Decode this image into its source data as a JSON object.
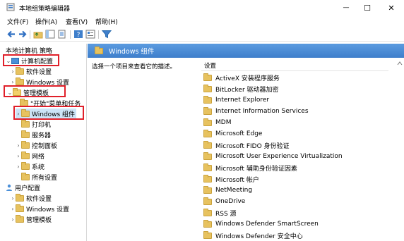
{
  "window": {
    "title": "本地组策略编辑器",
    "minimize_glyph": "—",
    "maximize_glyph": "☐",
    "close_glyph": "✕"
  },
  "menu": [
    "文件(F)",
    "操作(A)",
    "查看(V)",
    "帮助(H)"
  ],
  "toolbar": {
    "icons": [
      "back-arrow-icon",
      "forward-arrow-icon",
      "up-folder-icon",
      "show-hide-tree-icon",
      "export-list-icon",
      "help-icon",
      "properties-icon",
      "filter-icon"
    ]
  },
  "tree": {
    "root": "本地计算机 策略",
    "computer_config": "计算机配置",
    "software_settings_1": "软件设置",
    "windows_settings_1": "Windows 设置",
    "admin_templates_1": "管理模板",
    "start_menu": "\"开始\"菜单和任务",
    "windows_components": "Windows 组件",
    "printers": "打印机",
    "server": "服务器",
    "control_panel": "控制面板",
    "network": "网络",
    "system": "系统",
    "all_settings": "所有设置",
    "user_config": "用户配置",
    "software_settings_2": "软件设置",
    "windows_settings_2": "Windows 设置",
    "admin_templates_2": "管理模板"
  },
  "right_pane": {
    "header": "Windows 组件",
    "description": "选择一个项目来查看它的描述。",
    "column_header": "设置",
    "items": [
      "ActiveX 安装程序服务",
      "BitLocker 驱动器加密",
      "Internet Explorer",
      "Internet Information Services",
      "MDM",
      "Microsoft Edge",
      "Microsoft FIDO 身份验证",
      "Microsoft User Experience Virtualization",
      "Microsoft 辅助身份验证因素",
      "Microsoft 帐户",
      "NetMeeting",
      "OneDrive",
      "RSS 源",
      "Windows Defender SmartScreen",
      "Windows Defender 安全中心"
    ]
  },
  "colors": {
    "header_blue": "#3f7fcb",
    "folder_yellow": "#e7c25f",
    "highlight_red": "#e0202a"
  }
}
